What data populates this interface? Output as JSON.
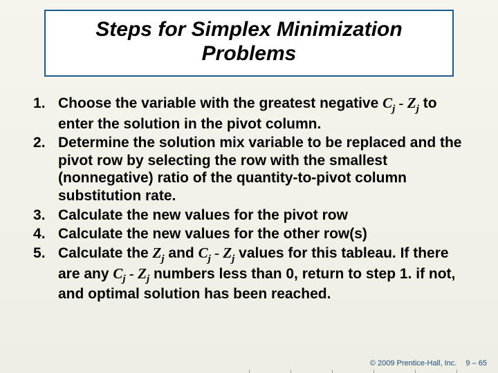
{
  "title": "Steps for Simplex Minimization Problems",
  "steps": [
    {
      "pre": "Choose the variable with the greatest negative ",
      "expr": "cjzj",
      "post": " to enter the solution in the pivot column."
    },
    {
      "pre": "Determine the solution mix variable to be replaced and the pivot row by selecting the row with the smallest (nonnegative) ratio of the quantity-to-pivot column substitution rate.",
      "expr": "",
      "post": ""
    },
    {
      "pre": "Calculate the new values for the pivot row",
      "expr": "",
      "post": ""
    },
    {
      "pre": "Calculate the new values for the other row(s)",
      "expr": "",
      "post": ""
    },
    {
      "pre": "Calculate the ",
      "expr": "zj_and_cjzj",
      "post": " values for this tableau. If there are any ",
      "expr2": "cjzj",
      "post2": " numbers less than 0, return to step 1. if not, and optimal solution has been reached."
    }
  ],
  "math": {
    "C": "C",
    "Z": "Z",
    "j": "j",
    "minus": " - ",
    "and": " and "
  },
  "footer": {
    "copyright": "© 2009 Prentice-Hall, Inc.",
    "page": "9 – 65"
  }
}
